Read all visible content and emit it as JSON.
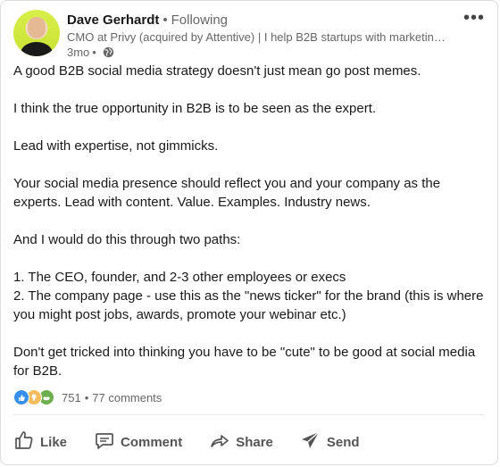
{
  "post": {
    "author": {
      "name": "Dave Gerhardt",
      "separator": "•",
      "follow_status": "Following",
      "headline": "CMO at Privy (acquired by Attentive) | I help B2B startups with marketin…",
      "time": "3mo",
      "time_separator": "•",
      "visibility_icon": "globe-icon"
    },
    "more_label": "•••",
    "paragraphs": [
      "A good B2B social media strategy doesn't just mean go post memes.",
      "I think the true opportunity in B2B is to be seen as the expert.",
      "Lead with expertise, not gimmicks.",
      "Your social media presence should reflect you and your company as the experts. Lead with content. Value. Examples. Industry news.",
      "And I would do this through two paths:",
      "1. The CEO, founder, and 2-3 other employees or execs",
      "2. The company page - use this as the \"news ticker\" for the brand (this is where you might post jobs, awards, promote your webinar etc.)",
      "Don't get tricked into thinking you have to be \"cute\" to be good at social media for B2B."
    ],
    "reactions": {
      "icons": [
        "like-icon",
        "insightful-icon",
        "support-icon"
      ],
      "count": "751",
      "separator": "•",
      "comments": "77 comments"
    },
    "actions": [
      {
        "label": "Like",
        "icon": "thumbs-up-icon"
      },
      {
        "label": "Comment",
        "icon": "comment-icon"
      },
      {
        "label": "Share",
        "icon": "share-arrow-icon"
      },
      {
        "label": "Send",
        "icon": "send-icon"
      }
    ]
  },
  "colors": {
    "like": "#378fe9",
    "insightful": "#f5bb5c",
    "support": "#6dae4f",
    "avatar_bg": "#c8e233"
  }
}
